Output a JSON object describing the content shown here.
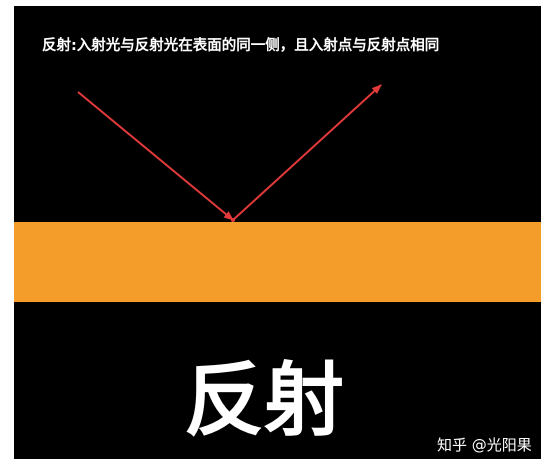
{
  "diagram": {
    "caption": "反射:入射光与反射光在表面的同一侧，且入射点与反射点相同",
    "title": "反射",
    "colors": {
      "background": "#000000",
      "surface": "#f49d2b",
      "ray": "#e23a3a",
      "text": "#ffffff"
    }
  },
  "watermark": {
    "text": "知乎 @光阳果"
  }
}
